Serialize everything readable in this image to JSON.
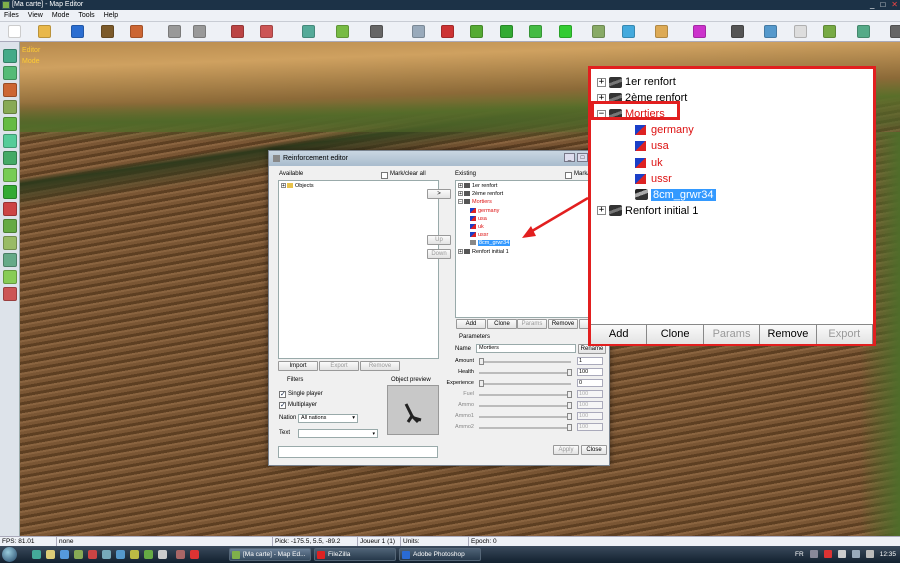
{
  "window": {
    "title": "[Ma carte] - Map Editor",
    "min": "_",
    "max": "□",
    "close": "✕"
  },
  "menu": [
    "Files",
    "View",
    "Mode",
    "Tools",
    "Help"
  ],
  "toolbar_icons": [
    "new-icon",
    "open-icon",
    "save-icon",
    "terrain-icon",
    "export-icon",
    "undo-icon",
    "redo-icon",
    "brush-icon",
    "paint-icon",
    "texture-icon",
    "height-icon",
    "grid-icon",
    "pointer-icon",
    "unit-icon",
    "road-icon",
    "zone-icon",
    "tree-icon",
    "rock-icon",
    "house-icon",
    "water-icon",
    "camera-icon",
    "script-icon",
    "trigger-icon",
    "sound-icon",
    "light-icon",
    "layer-icon",
    "reinforcement-icon",
    "options-icon"
  ],
  "hud": {
    "line1": "Editor",
    "line2": "Mode"
  },
  "statusbar": {
    "fps": "FPS: 81.01",
    "mode": "none",
    "pick": "Pick: -175.5, 5.5, -89.2",
    "player": "Joueur 1 (1)",
    "units": "Units:",
    "epoch": "Epoch: 0"
  },
  "taskbar": {
    "tasks": [
      "[Ma carte] - Map Ed...",
      "FileZilla",
      "Adobe Photoshop"
    ],
    "lang": "FR",
    "clock": "12:35"
  },
  "dialog": {
    "title": "Reinforcement editor",
    "available_label": "Available",
    "mark_clear_all": "Mark/clear all",
    "objects_node": "Objects",
    "move_right": ">",
    "up": "Up",
    "down": "Down",
    "existing_label": "Existing",
    "mark_clear_all2": "Mark/",
    "tree": [
      {
        "label": "1er renfort",
        "kind": "group",
        "expander": "+"
      },
      {
        "label": "2ème renfort",
        "kind": "group",
        "expander": "+"
      },
      {
        "label": "Mortiers",
        "kind": "group",
        "expander": "−",
        "red": true
      },
      {
        "label": "germany",
        "kind": "flag",
        "red": true
      },
      {
        "label": "usa",
        "kind": "flag",
        "red": true
      },
      {
        "label": "uk",
        "kind": "flag",
        "red": true
      },
      {
        "label": "ussr",
        "kind": "flag",
        "red": true
      },
      {
        "label": "8cm_grwr34",
        "kind": "unit",
        "selected": true
      },
      {
        "label": "Renfort initial 1",
        "kind": "group",
        "expander": "+"
      }
    ],
    "tree_buttons": [
      "Add",
      "Clone",
      "Params",
      "Remove",
      "E"
    ],
    "left_buttons": [
      "Import",
      "Export",
      "Remove"
    ],
    "filters_label": "Filters",
    "single_player": "Single player",
    "multiplayer": "Multiplayer",
    "nation_label": "Nation",
    "nation_value": "All nations",
    "text_label": "Text",
    "object_preview": "Object preview",
    "parameters_label": "Parameters",
    "name_label": "Name",
    "name_value": "Mortiers",
    "rename": "Rename",
    "params": [
      {
        "label": "Amount",
        "value": "1",
        "level": 0,
        "enabled": true
      },
      {
        "label": "Health",
        "value": "100",
        "level": 1,
        "enabled": true
      },
      {
        "label": "Experience",
        "value": "0",
        "level": 0,
        "enabled": true
      },
      {
        "label": "Fuel",
        "value": "100",
        "level": 1,
        "enabled": false
      },
      {
        "label": "Ammo",
        "value": "100",
        "level": 1,
        "enabled": false
      },
      {
        "label": "Ammo1",
        "value": "100",
        "level": 1,
        "enabled": false
      },
      {
        "label": "Ammo2",
        "value": "100",
        "level": 1,
        "enabled": false
      }
    ],
    "apply": "Apply",
    "close": "Close"
  },
  "callout": {
    "tree": [
      {
        "label": "1er renfort",
        "kind": "group",
        "expander": "+"
      },
      {
        "label": "2ème renfort",
        "kind": "group",
        "expander": "+"
      },
      {
        "label": "Mortiers",
        "kind": "group",
        "expander": "−",
        "red": true
      },
      {
        "label": "germany",
        "kind": "flag",
        "red": true
      },
      {
        "label": "usa",
        "kind": "flag",
        "red": true
      },
      {
        "label": "uk",
        "kind": "flag",
        "red": true
      },
      {
        "label": "ussr",
        "kind": "flag",
        "red": true
      },
      {
        "label": "8cm_grwr34",
        "kind": "unit",
        "selected": true
      },
      {
        "label": "Renfort initial 1",
        "kind": "group",
        "expander": "+"
      }
    ],
    "buttons": [
      {
        "label": "Add",
        "enabled": true
      },
      {
        "label": "Clone",
        "enabled": true
      },
      {
        "label": "Params",
        "enabled": false
      },
      {
        "label": "Remove",
        "enabled": true
      },
      {
        "label": "Export",
        "enabled": false
      }
    ]
  },
  "colors": {
    "highlight": "#e21f1f",
    "selection": "#3399ff",
    "node_red": "#d11"
  }
}
